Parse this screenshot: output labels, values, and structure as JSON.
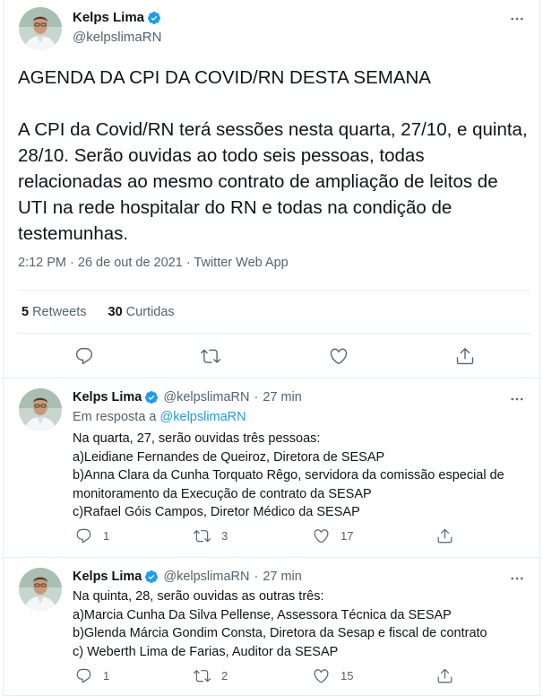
{
  "author": {
    "name": "Kelps Lima",
    "handle": "@kelpslimaRN"
  },
  "main_tweet": {
    "heading": "AGENDA DA CPI DA COVID/RN DESTA SEMANA",
    "body": "A CPI da Covid/RN terá sessões nesta quarta, 27/10, e quinta, 28/10. Serão ouvidas ao todo seis pessoas, todas relacionadas ao mesmo contrato de ampliação de leitos de UTI na rede hospitalar do RN e todas na condição de testemunhas.",
    "meta": "2:12 PM · 26 de out de 2021 · Twitter Web App",
    "retweets_count": "5",
    "retweets_label": "Retweets",
    "likes_count": "30",
    "likes_label": "Curtidas"
  },
  "replies": [
    {
      "name": "Kelps Lima",
      "handle": "@kelpslimaRN",
      "dot": "·",
      "time": "27 min",
      "reply_to_label": "Em resposta a",
      "reply_to_handle": "@kelpslimaRN",
      "lines": [
        "Na quarta, 27, serão ouvidas três pessoas:",
        "a)Leidiane Fernandes de Queiroz, Diretora de SESAP",
        "b)Anna Clara da Cunha Torquato Rêgo, servidora da comissão especial de monitoramento da Execução de contrato da SESAP",
        "c)Rafael Góis Campos, Diretor Médico da SESAP"
      ],
      "reply_count": "1",
      "retweet_count": "3",
      "like_count": "17"
    },
    {
      "name": "Kelps Lima",
      "handle": "@kelpslimaRN",
      "dot": "·",
      "time": "27 min",
      "lines": [
        "Na quinta, 28, serão ouvidas as outras três:",
        "a)Marcia Cunha Da Silva Pellense, Assessora Técnica da SESAP",
        "b)Glenda Márcia Gondim Consta, Diretora da Sesap e fiscal de contrato",
        "c) Weberth Lima de Farias, Auditor da SESAP"
      ],
      "reply_count": "1",
      "retweet_count": "2",
      "like_count": "15"
    }
  ],
  "icons": {
    "verified": "verified-badge-icon",
    "more": "more-dots-icon",
    "reply": "reply-icon",
    "retweet": "retweet-icon",
    "like": "heart-icon",
    "share": "share-icon"
  },
  "colors": {
    "accent": "#1d9bf0",
    "text": "#0f1419",
    "secondary": "#536471",
    "border": "#e6ecf0"
  }
}
